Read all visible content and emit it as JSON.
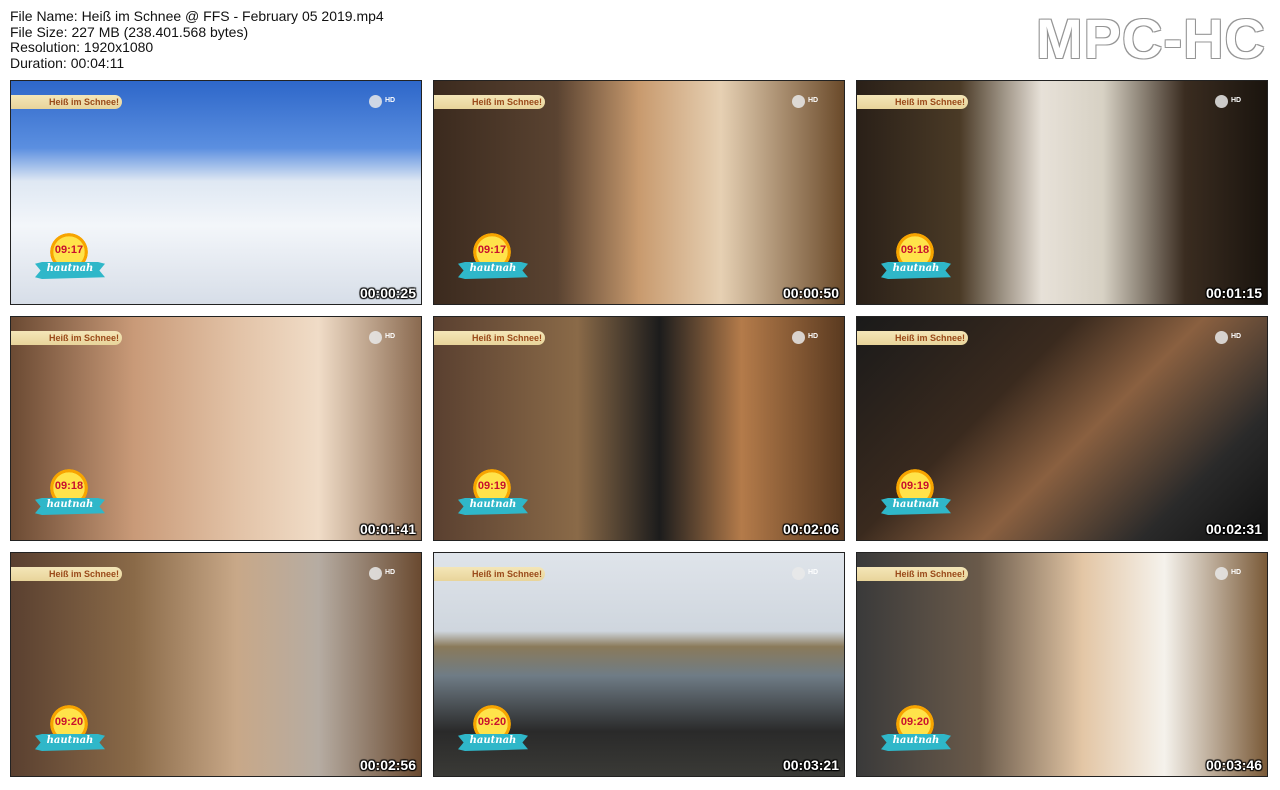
{
  "file_info": {
    "file_name": "File Name: Heiß im Schnee @ FFS - February 05 2019.mp4",
    "file_size": "File Size: 227 MB (238.401.568 bytes)",
    "resolution": "Resolution: 1920x1080",
    "duration": "Duration: 00:04:11"
  },
  "logo": "MPC-HC",
  "overlay": {
    "banner_text": "Heiß im Schnee!",
    "channel_badge": "HD",
    "show_word": "hautnah"
  },
  "thumbnails": [
    {
      "clock": "09:17",
      "timecode": "00:00:25"
    },
    {
      "clock": "09:17",
      "timecode": "00:00:50"
    },
    {
      "clock": "09:18",
      "timecode": "00:01:15"
    },
    {
      "clock": "09:18",
      "timecode": "00:01:41"
    },
    {
      "clock": "09:19",
      "timecode": "00:02:06"
    },
    {
      "clock": "09:19",
      "timecode": "00:02:31"
    },
    {
      "clock": "09:20",
      "timecode": "00:02:56"
    },
    {
      "clock": "09:20",
      "timecode": "00:03:21"
    },
    {
      "clock": "09:20",
      "timecode": "00:03:46"
    }
  ]
}
